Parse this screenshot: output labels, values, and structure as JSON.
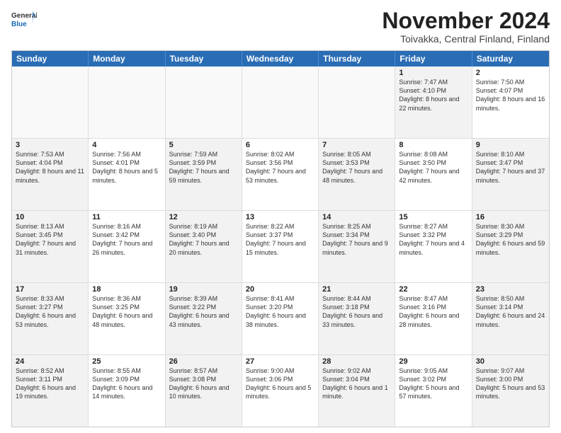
{
  "header": {
    "logo": {
      "general": "General",
      "blue": "Blue"
    },
    "title": "November 2024",
    "subtitle": "Toivakka, Central Finland, Finland"
  },
  "calendar": {
    "weekdays": [
      "Sunday",
      "Monday",
      "Tuesday",
      "Wednesday",
      "Thursday",
      "Friday",
      "Saturday"
    ],
    "rows": [
      [
        {
          "day": "",
          "info": "",
          "empty": true
        },
        {
          "day": "",
          "info": "",
          "empty": true
        },
        {
          "day": "",
          "info": "",
          "empty": true
        },
        {
          "day": "",
          "info": "",
          "empty": true
        },
        {
          "day": "",
          "info": "",
          "empty": true
        },
        {
          "day": "1",
          "info": "Sunrise: 7:47 AM\nSunset: 4:10 PM\nDaylight: 8 hours and 22 minutes.",
          "shaded": true
        },
        {
          "day": "2",
          "info": "Sunrise: 7:50 AM\nSunset: 4:07 PM\nDaylight: 8 hours and 16 minutes.",
          "shaded": false
        }
      ],
      [
        {
          "day": "3",
          "info": "Sunrise: 7:53 AM\nSunset: 4:04 PM\nDaylight: 8 hours and 11 minutes.",
          "shaded": true
        },
        {
          "day": "4",
          "info": "Sunrise: 7:56 AM\nSunset: 4:01 PM\nDaylight: 8 hours and 5 minutes.",
          "shaded": false
        },
        {
          "day": "5",
          "info": "Sunrise: 7:59 AM\nSunset: 3:59 PM\nDaylight: 7 hours and 59 minutes.",
          "shaded": true
        },
        {
          "day": "6",
          "info": "Sunrise: 8:02 AM\nSunset: 3:56 PM\nDaylight: 7 hours and 53 minutes.",
          "shaded": false
        },
        {
          "day": "7",
          "info": "Sunrise: 8:05 AM\nSunset: 3:53 PM\nDaylight: 7 hours and 48 minutes.",
          "shaded": true
        },
        {
          "day": "8",
          "info": "Sunrise: 8:08 AM\nSunset: 3:50 PM\nDaylight: 7 hours and 42 minutes.",
          "shaded": false
        },
        {
          "day": "9",
          "info": "Sunrise: 8:10 AM\nSunset: 3:47 PM\nDaylight: 7 hours and 37 minutes.",
          "shaded": true
        }
      ],
      [
        {
          "day": "10",
          "info": "Sunrise: 8:13 AM\nSunset: 3:45 PM\nDaylight: 7 hours and 31 minutes.",
          "shaded": true
        },
        {
          "day": "11",
          "info": "Sunrise: 8:16 AM\nSunset: 3:42 PM\nDaylight: 7 hours and 26 minutes.",
          "shaded": false
        },
        {
          "day": "12",
          "info": "Sunrise: 8:19 AM\nSunset: 3:40 PM\nDaylight: 7 hours and 20 minutes.",
          "shaded": true
        },
        {
          "day": "13",
          "info": "Sunrise: 8:22 AM\nSunset: 3:37 PM\nDaylight: 7 hours and 15 minutes.",
          "shaded": false
        },
        {
          "day": "14",
          "info": "Sunrise: 8:25 AM\nSunset: 3:34 PM\nDaylight: 7 hours and 9 minutes.",
          "shaded": true
        },
        {
          "day": "15",
          "info": "Sunrise: 8:27 AM\nSunset: 3:32 PM\nDaylight: 7 hours and 4 minutes.",
          "shaded": false
        },
        {
          "day": "16",
          "info": "Sunrise: 8:30 AM\nSunset: 3:29 PM\nDaylight: 6 hours and 59 minutes.",
          "shaded": true
        }
      ],
      [
        {
          "day": "17",
          "info": "Sunrise: 8:33 AM\nSunset: 3:27 PM\nDaylight: 6 hours and 53 minutes.",
          "shaded": true
        },
        {
          "day": "18",
          "info": "Sunrise: 8:36 AM\nSunset: 3:25 PM\nDaylight: 6 hours and 48 minutes.",
          "shaded": false
        },
        {
          "day": "19",
          "info": "Sunrise: 8:39 AM\nSunset: 3:22 PM\nDaylight: 6 hours and 43 minutes.",
          "shaded": true
        },
        {
          "day": "20",
          "info": "Sunrise: 8:41 AM\nSunset: 3:20 PM\nDaylight: 6 hours and 38 minutes.",
          "shaded": false
        },
        {
          "day": "21",
          "info": "Sunrise: 8:44 AM\nSunset: 3:18 PM\nDaylight: 6 hours and 33 minutes.",
          "shaded": true
        },
        {
          "day": "22",
          "info": "Sunrise: 8:47 AM\nSunset: 3:16 PM\nDaylight: 6 hours and 28 minutes.",
          "shaded": false
        },
        {
          "day": "23",
          "info": "Sunrise: 8:50 AM\nSunset: 3:14 PM\nDaylight: 6 hours and 24 minutes.",
          "shaded": true
        }
      ],
      [
        {
          "day": "24",
          "info": "Sunrise: 8:52 AM\nSunset: 3:11 PM\nDaylight: 6 hours and 19 minutes.",
          "shaded": true
        },
        {
          "day": "25",
          "info": "Sunrise: 8:55 AM\nSunset: 3:09 PM\nDaylight: 6 hours and 14 minutes.",
          "shaded": false
        },
        {
          "day": "26",
          "info": "Sunrise: 8:57 AM\nSunset: 3:08 PM\nDaylight: 6 hours and 10 minutes.",
          "shaded": true
        },
        {
          "day": "27",
          "info": "Sunrise: 9:00 AM\nSunset: 3:06 PM\nDaylight: 6 hours and 5 minutes.",
          "shaded": false
        },
        {
          "day": "28",
          "info": "Sunrise: 9:02 AM\nSunset: 3:04 PM\nDaylight: 6 hours and 1 minute.",
          "shaded": true
        },
        {
          "day": "29",
          "info": "Sunrise: 9:05 AM\nSunset: 3:02 PM\nDaylight: 5 hours and 57 minutes.",
          "shaded": false
        },
        {
          "day": "30",
          "info": "Sunrise: 9:07 AM\nSunset: 3:00 PM\nDaylight: 5 hours and 53 minutes.",
          "shaded": true
        }
      ]
    ]
  }
}
